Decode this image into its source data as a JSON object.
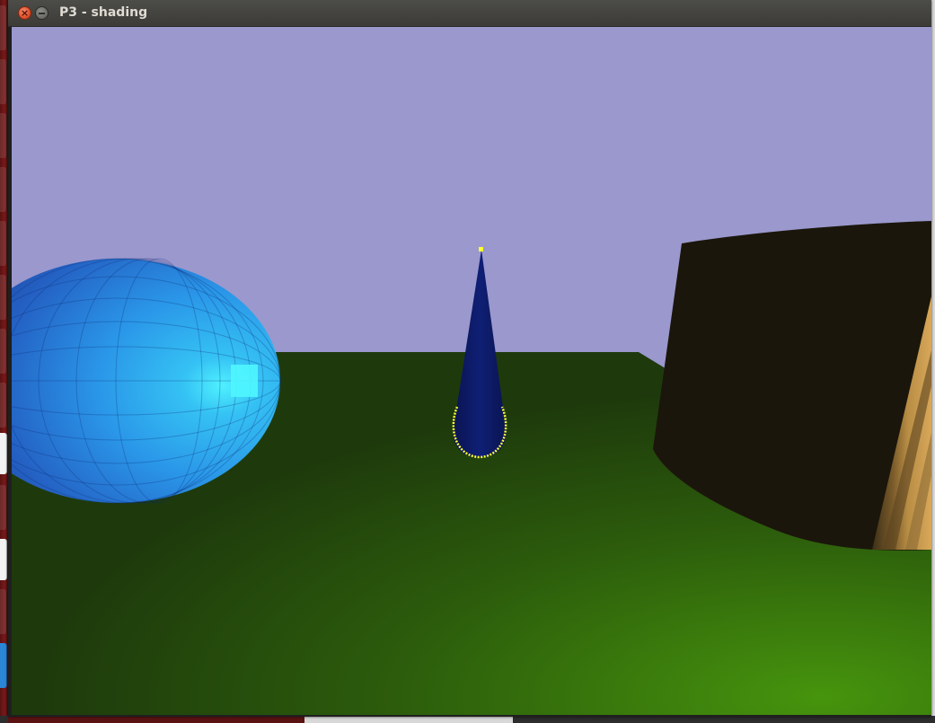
{
  "window": {
    "title": "P3 - shading",
    "controls": {
      "close_icon": "close-icon",
      "minimize_icon": "minimize-icon"
    }
  },
  "scene": {
    "sky_color": "#9a98cd",
    "ground_color_dark": "#1e3a0c",
    "ground_color_light": "#46940d",
    "sphere_color": "#2aa6f0",
    "cone_color": "#0c1a6b",
    "cone_outline_color": "#ffff33",
    "cylinder_color": "#1b160b",
    "cylinder_side_color": "#c59a4e"
  }
}
